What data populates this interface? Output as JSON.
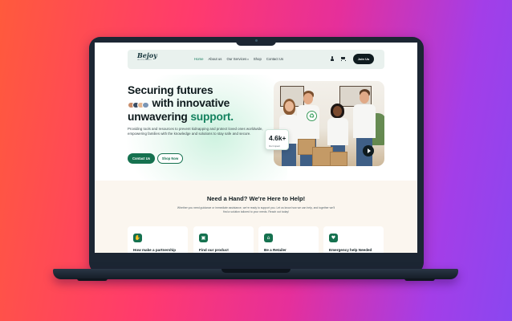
{
  "navbar": {
    "logo": "Bejoy",
    "logo_tagline": "HELPING HANDS",
    "links": [
      {
        "label": "Home"
      },
      {
        "label": "About us"
      },
      {
        "label": "Our Services"
      },
      {
        "label": "Shop"
      },
      {
        "label": "Contact Us"
      }
    ],
    "cta": "Join Us"
  },
  "hero": {
    "title_line1": "Securing futures",
    "title_line2": "with innovative",
    "title_line3_part1": "unwavering",
    "title_line3_accent": "support.",
    "description": "Providing tools and resources to prevent kidnapping and protect loved ones worldwide, empowering families with the knowledge and solutions to stay safe and secure.",
    "primary_button": "Contact Us",
    "secondary_button": "Shop Now",
    "stat_value": "4.6k+",
    "stat_label": "Our Impact"
  },
  "help": {
    "title": "Need a Hand? We're Here to Help!",
    "description": "Whether you need guidance or immediate assistance, we're ready to support you. Let us know how we can help, and together we'll find a solution tailored to your needs. Reach out today!",
    "cards": [
      {
        "title": "How make a  partnership",
        "icon": "handshake-icon"
      },
      {
        "title": "Find our product",
        "icon": "shopping-bag-icon"
      },
      {
        "title": "Be a Retailer",
        "icon": "store-icon"
      },
      {
        "title": "Emergency help Needed",
        "icon": "heart-icon"
      }
    ]
  },
  "colors": {
    "accent": "#15714f",
    "dark": "#0f1b1f",
    "section_bg": "#fbf6ef"
  }
}
